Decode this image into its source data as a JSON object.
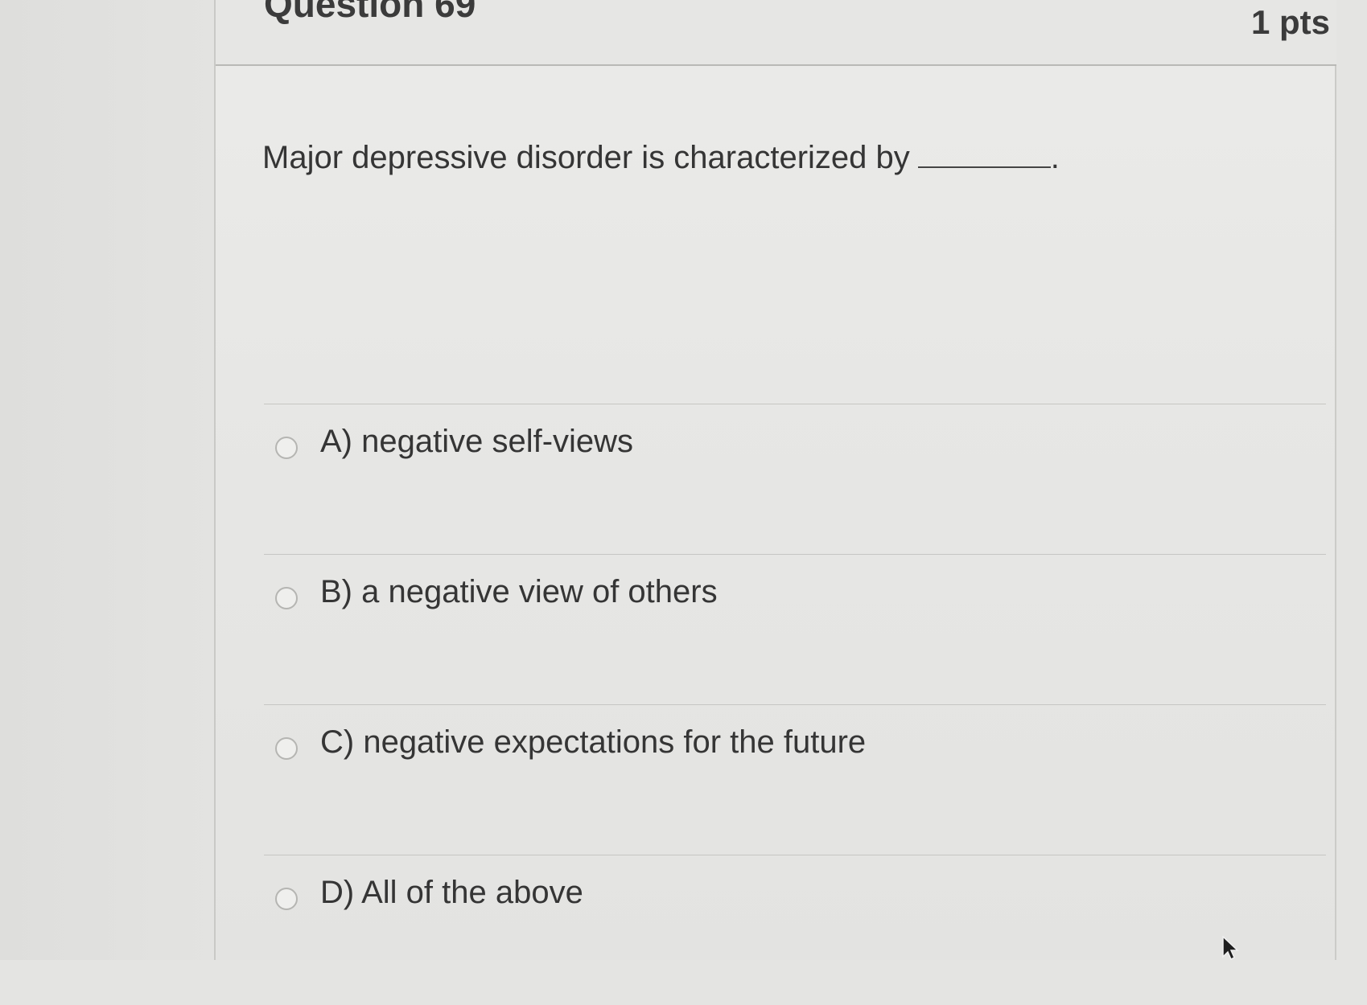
{
  "question": {
    "title": "Question 69",
    "points": "1 pts",
    "text": "Major depressive disorder is characterized by",
    "blank_end": "."
  },
  "answers": [
    {
      "label": "A) negative self-views"
    },
    {
      "label": "B) a negative view of others"
    },
    {
      "label": "C) negative expectations for the future"
    },
    {
      "label": "D) All of the above"
    }
  ],
  "icons": {
    "cursor": "mouse-pointer-icon",
    "radio": "radio-button"
  }
}
